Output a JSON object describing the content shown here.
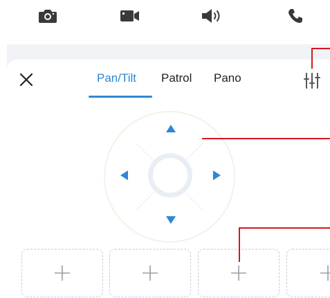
{
  "toolbar": {
    "icons": [
      "camera-icon",
      "video-icon",
      "speaker-icon",
      "phone-icon"
    ]
  },
  "tabs": [
    {
      "label": "Pan/Tilt",
      "active": true
    },
    {
      "label": "Patrol",
      "active": false
    },
    {
      "label": "Pano",
      "active": false
    }
  ],
  "colors": {
    "accent": "#2f86d4",
    "annotation": "#d4161e",
    "icon": "#3a3a3a"
  },
  "joystick": {
    "arrows": [
      "up",
      "down",
      "left",
      "right"
    ]
  },
  "presets": {
    "add_symbol": "+",
    "slots": 4
  }
}
